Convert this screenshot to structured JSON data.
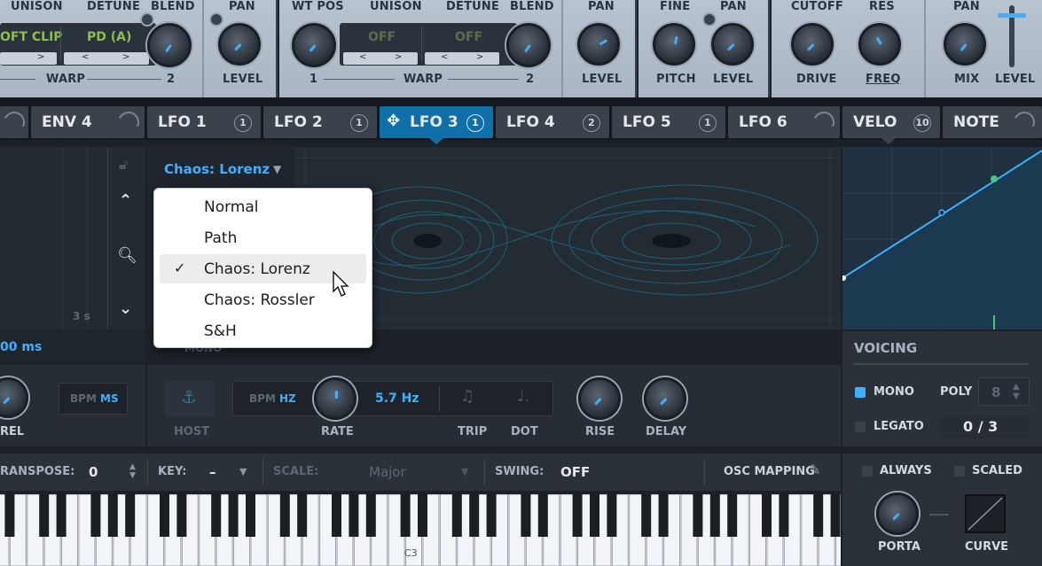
{
  "osc_a": {
    "unison_label": "UNISON",
    "detune_label": "DETUNE",
    "blend_label": "BLEND",
    "warp_display": "OFT CLIP",
    "warp2_display": "PD (A)",
    "warp_label": "WARP",
    "blend_value": "2",
    "pan_label": "PAN",
    "level_label": "LEVEL"
  },
  "osc_b": {
    "wtpos_label": "WT POS",
    "unison_label": "UNISON",
    "detune_label": "DETUNE",
    "blend_label": "BLEND",
    "warp_display": "OFF",
    "warp2_display": "OFF",
    "warp_label": "WARP",
    "wtpos_value": "1",
    "blend_value": "2",
    "pan_label": "PAN",
    "level_label": "LEVEL"
  },
  "sub": {
    "fine_label": "FINE",
    "pan_label": "PAN",
    "pitch_label": "PITCH",
    "level_label": "LEVEL"
  },
  "filter": {
    "cutoff_label": "CUTOFF",
    "res_label": "RES",
    "drive_label": "DRIVE",
    "freq_label": "FREQ",
    "pan_label": "PAN",
    "mix_label": "MIX",
    "level_label": "LEVEL"
  },
  "tabs": [
    {
      "label": "ENV 4",
      "badge": ""
    },
    {
      "label": "LFO 1",
      "badge": "1"
    },
    {
      "label": "LFO 2",
      "badge": "1"
    },
    {
      "label": "LFO 3",
      "badge": "1"
    },
    {
      "label": "LFO 4",
      "badge": "2"
    },
    {
      "label": "LFO 5",
      "badge": "1"
    },
    {
      "label": "LFO 6",
      "badge": ""
    },
    {
      "label": "VELO",
      "badge": "10"
    },
    {
      "label": "NOTE",
      "badge": ""
    }
  ],
  "env": {
    "time_marker": "3 s",
    "time_value": "00 ms",
    "rel_label": "REL",
    "bpm_label": "BPM",
    "ms_label": "MS"
  },
  "lfo": {
    "mode_selected": "Chaos: Lorenz",
    "mono_label": "MONO",
    "host_label": "HOST",
    "bpm_label": "BPM",
    "hz_label": "HZ",
    "rate_value": "5.7 Hz",
    "rate_label": "RATE",
    "trip_label": "TRIP",
    "dot_label": "DOT",
    "rise_label": "RISE",
    "delay_label": "DELAY"
  },
  "menu": {
    "items": [
      "Normal",
      "Path",
      "Chaos: Lorenz",
      "Chaos: Rossler",
      "S&H"
    ],
    "checked": "Chaos: Lorenz"
  },
  "voicing": {
    "title": "VOICING",
    "mono_label": "MONO",
    "poly_label": "POLY",
    "poly_value": "8",
    "legato_label": "LEGATO",
    "voices_value": "0 / 3"
  },
  "keyboard_bar": {
    "transpose_label": "RANSPOSE:",
    "transpose_value": "0",
    "key_label": "KEY:",
    "key_value": "–",
    "scale_label": "SCALE:",
    "scale_value": "Major",
    "swing_label": "SWING:",
    "swing_value": "OFF",
    "osc_mapping_label": "OSC MAPPING",
    "c3_label": "C3"
  },
  "porta": {
    "always_label": "ALWAYS",
    "scaled_label": "SCALED",
    "porta_label": "PORTA",
    "curve_label": "CURVE"
  },
  "colors": {
    "accent": "#3db0ff",
    "tab_active": "#0f6fa8",
    "display_text": "#8fbf4a"
  }
}
